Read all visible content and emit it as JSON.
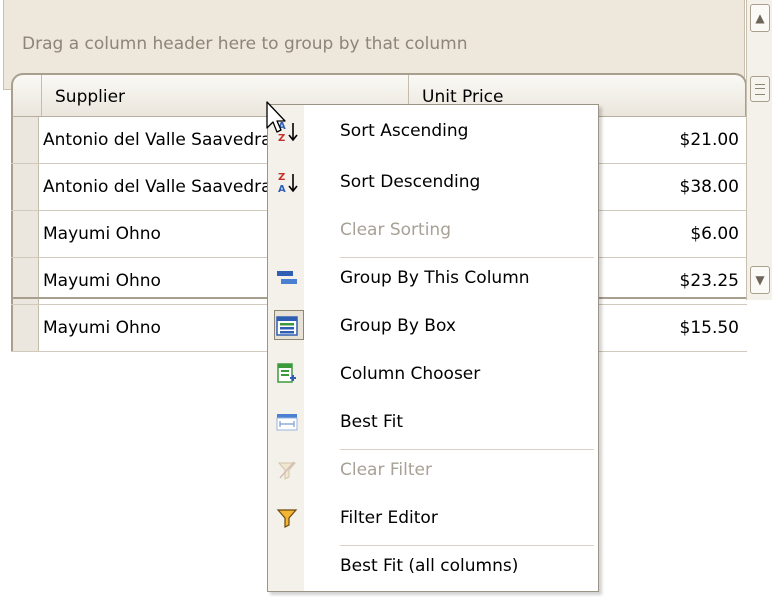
{
  "group_panel": {
    "text": "Drag a column header here to group by that column"
  },
  "columns": {
    "supplier": "Supplier",
    "unit_price": "Unit Price"
  },
  "rows": [
    {
      "supplier": "Antonio del Valle Saavedra",
      "price": "$21.00"
    },
    {
      "supplier": "Antonio del Valle Saavedra",
      "price": "$38.00"
    },
    {
      "supplier": "Mayumi Ohno",
      "price": "$6.00"
    },
    {
      "supplier": "Mayumi Ohno",
      "price": "$23.25"
    },
    {
      "supplier": "Mayumi Ohno",
      "price": "$15.50"
    }
  ],
  "menu": {
    "items": [
      {
        "label": "Sort Ascending",
        "icon": "sort-ascending-icon",
        "enabled": true
      },
      {
        "label": "Sort Descending",
        "icon": "sort-descending-icon",
        "enabled": true
      },
      {
        "label": "Clear Sorting",
        "icon": "",
        "enabled": false
      },
      {
        "label": "Group By This Column",
        "icon": "group-by-column-icon",
        "enabled": true
      },
      {
        "label": "Group By Box",
        "icon": "group-by-box-icon",
        "enabled": true,
        "checked": true
      },
      {
        "label": "Column Chooser",
        "icon": "column-chooser-icon",
        "enabled": true
      },
      {
        "label": "Best Fit",
        "icon": "best-fit-icon",
        "enabled": true
      },
      {
        "label": "Clear Filter",
        "icon": "clear-filter-icon",
        "enabled": false
      },
      {
        "label": "Filter Editor",
        "icon": "filter-editor-icon",
        "enabled": true
      },
      {
        "label": "Best Fit (all columns)",
        "icon": "",
        "enabled": true
      }
    ]
  },
  "colors": {
    "accent_blue": "#2f5fb3",
    "disabled_text": "#a7a196",
    "panel_bg": "#ede7dc"
  }
}
